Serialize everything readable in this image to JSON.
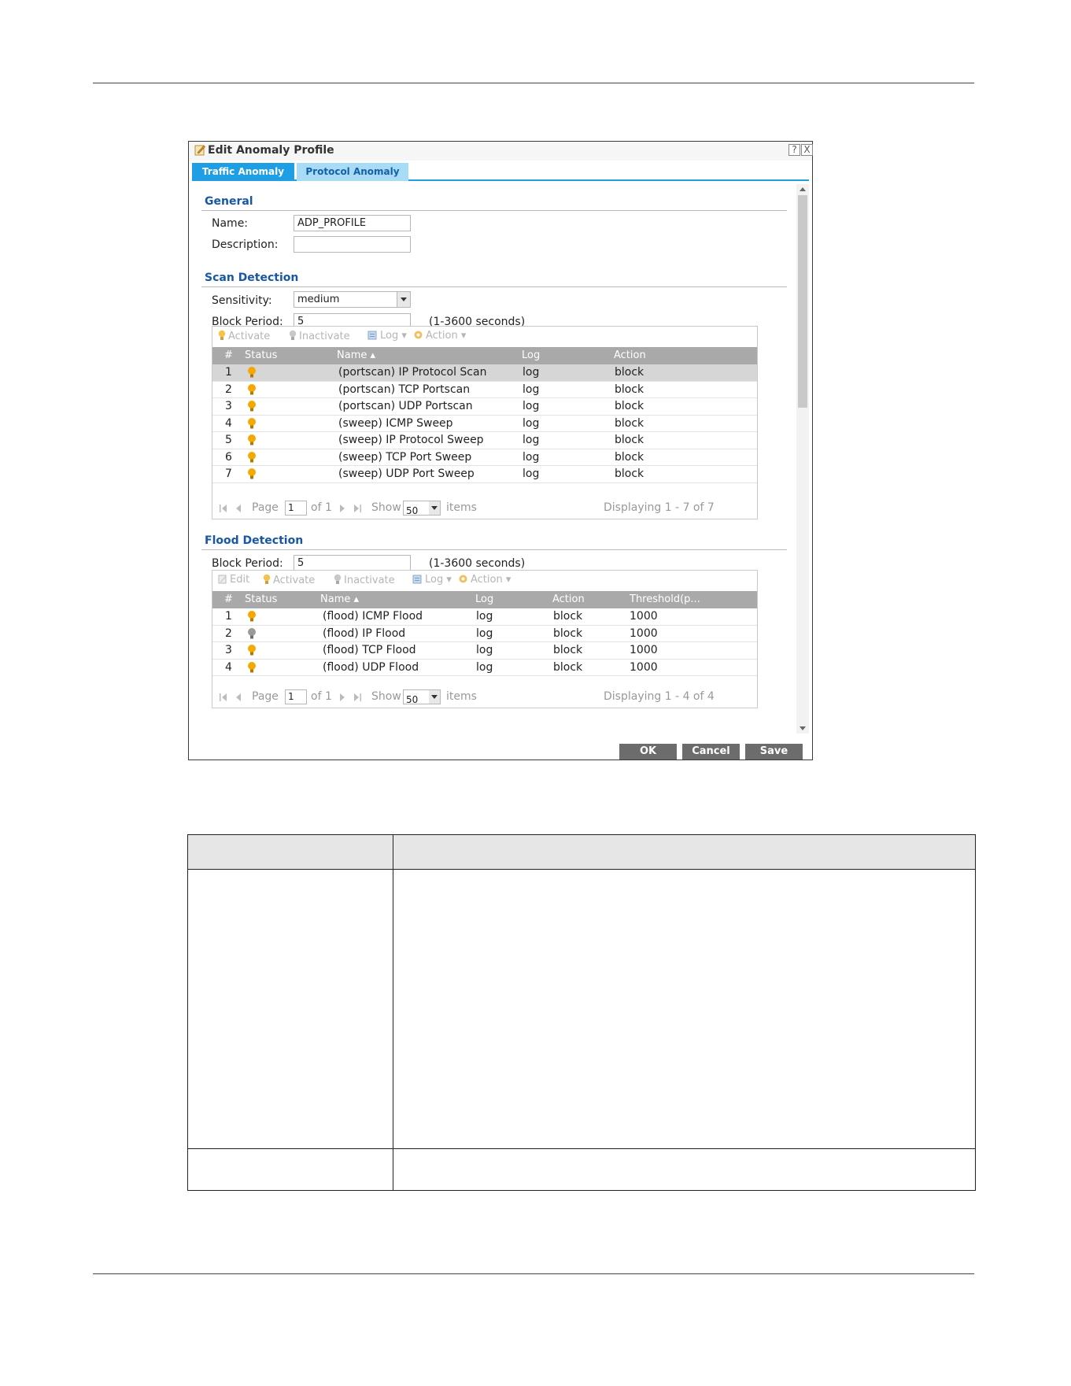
{
  "dialog": {
    "title": "Edit Anomaly Profile",
    "help_label": "?",
    "close_label": "X",
    "tabs": [
      {
        "label": "Traffic Anomaly",
        "active": true
      },
      {
        "label": "Protocol Anomaly",
        "active": false
      }
    ],
    "general": {
      "heading": "General",
      "name_label": "Name:",
      "name_value": "ADP_PROFILE",
      "description_label": "Description:",
      "description_value": ""
    },
    "scan": {
      "heading": "Scan Detection",
      "sensitivity_label": "Sensitivity:",
      "sensitivity_value": "medium",
      "block_period_label": "Block Period:",
      "block_period_value": "5",
      "block_period_hint": "(1-3600 seconds)",
      "toolbar": {
        "activate": "Activate",
        "inactivate": "Inactivate",
        "log": "Log",
        "action": "Action"
      },
      "columns": {
        "num": "#",
        "status": "Status",
        "name": "Name",
        "log": "Log",
        "action": "Action"
      },
      "rows": [
        {
          "num": "1",
          "status": "on",
          "name": "(portscan) IP Protocol Scan",
          "log": "log",
          "action": "block"
        },
        {
          "num": "2",
          "status": "on",
          "name": "(portscan) TCP Portscan",
          "log": "log",
          "action": "block"
        },
        {
          "num": "3",
          "status": "on",
          "name": "(portscan) UDP Portscan",
          "log": "log",
          "action": "block"
        },
        {
          "num": "4",
          "status": "on",
          "name": "(sweep) ICMP Sweep",
          "log": "log",
          "action": "block"
        },
        {
          "num": "5",
          "status": "on",
          "name": "(sweep) IP Protocol Sweep",
          "log": "log",
          "action": "block"
        },
        {
          "num": "6",
          "status": "on",
          "name": "(sweep) TCP Port Sweep",
          "log": "log",
          "action": "block"
        },
        {
          "num": "7",
          "status": "on",
          "name": "(sweep) UDP Port Sweep",
          "log": "log",
          "action": "block"
        }
      ],
      "pager": {
        "page_label": "Page",
        "page_value": "1",
        "of_label": "of 1",
        "show_label": "Show",
        "show_value": "50",
        "items_label": "items",
        "displaying": "Displaying 1 - 7 of 7"
      }
    },
    "flood": {
      "heading": "Flood Detection",
      "block_period_label": "Block Period:",
      "block_period_value": "5",
      "block_period_hint": "(1-3600 seconds)",
      "toolbar": {
        "edit": "Edit",
        "activate": "Activate",
        "inactivate": "Inactivate",
        "log": "Log",
        "action": "Action"
      },
      "columns": {
        "num": "#",
        "status": "Status",
        "name": "Name",
        "log": "Log",
        "action": "Action",
        "threshold": "Threshold(p..."
      },
      "rows": [
        {
          "num": "1",
          "status": "on",
          "name": "(flood) ICMP Flood",
          "log": "log",
          "action": "block",
          "threshold": "1000"
        },
        {
          "num": "2",
          "status": "off",
          "name": "(flood) IP Flood",
          "log": "log",
          "action": "block",
          "threshold": "1000"
        },
        {
          "num": "3",
          "status": "on",
          "name": "(flood) TCP Flood",
          "log": "log",
          "action": "block",
          "threshold": "1000"
        },
        {
          "num": "4",
          "status": "on",
          "name": "(flood) UDP Flood",
          "log": "log",
          "action": "block",
          "threshold": "1000"
        }
      ],
      "pager": {
        "page_label": "Page",
        "page_value": "1",
        "of_label": "of 1",
        "show_label": "Show",
        "show_value": "50",
        "items_label": "items",
        "displaying": "Displaying 1 - 4 of 4"
      }
    },
    "buttons": {
      "ok": "OK",
      "cancel": "Cancel",
      "save": "Save"
    }
  },
  "colors": {
    "accent": "#1e9ee4",
    "heading": "#1757a5",
    "bulb_on": "#f5a800",
    "bulb_off": "#9a9a9a",
    "header_gray": "#a9a9a9"
  }
}
